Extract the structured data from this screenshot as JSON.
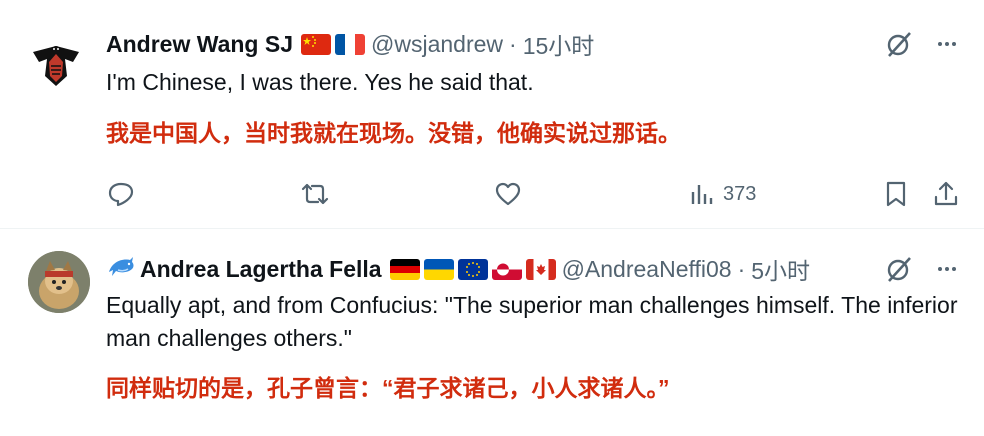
{
  "tweets": [
    {
      "name": "Andrew Wang SJ",
      "flags": [
        "china-flag",
        "france-flag"
      ],
      "handle": "@wsjandrew",
      "separator": "·",
      "time": "15小时",
      "text": "I'm Chinese, I was there. Yes he said that.",
      "translation": "我是中国人，当时我就在现场。没错，他确实说过那话。",
      "views": "373"
    },
    {
      "name": "Andrea Lagertha Fella",
      "name_emoji": "dolphin-icon",
      "flags": [
        "germany-flag",
        "ukraine-flag",
        "eu-flag",
        "greenland-flag",
        "canada-flag"
      ],
      "handle": "@AndreaNeffi08",
      "separator": "·",
      "time": "5小时",
      "text": "Equally apt, and from Confucius: \"The superior man challenges himself. The inferior man challenges others.\"",
      "translation": "同样贴切的是，孔子曾言：“君子求诸己，小人求诸人。”"
    }
  ],
  "colors": {
    "translation": "#d12c0e",
    "secondary": "#536471",
    "text": "#0f1419"
  }
}
